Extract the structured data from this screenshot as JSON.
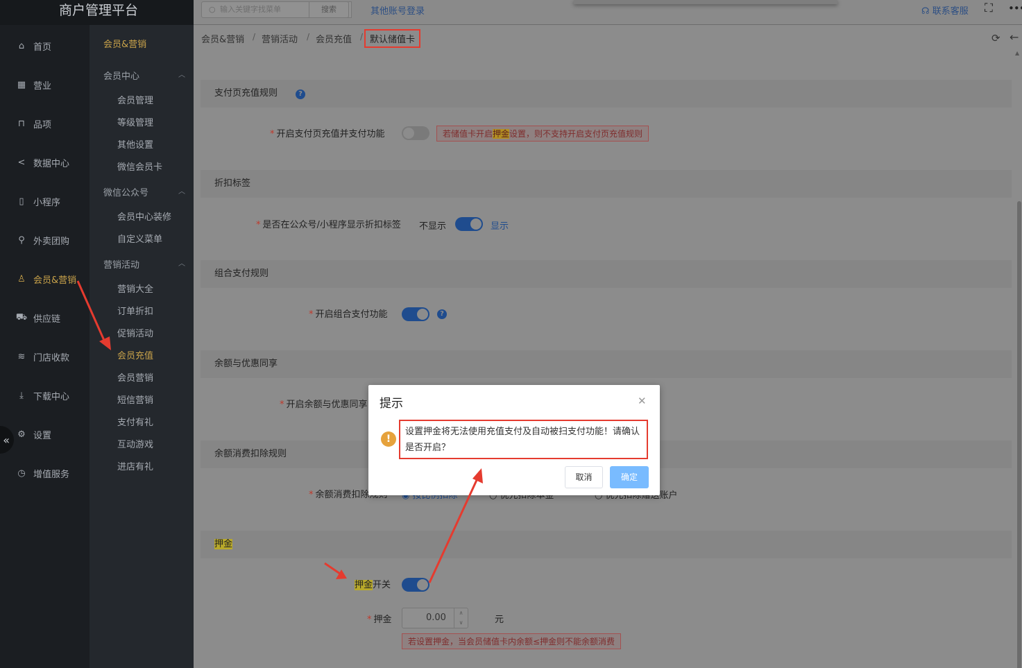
{
  "app": {
    "title": "商户管理平台"
  },
  "topbar": {
    "search_placeholder": "输入关键字找菜单",
    "search_button": "搜索",
    "other_login": "其他账号登录",
    "contact": "联系客服"
  },
  "nav": {
    "items": [
      {
        "label": "首页",
        "icon": "home-icon"
      },
      {
        "label": "营业",
        "icon": "calendar-icon"
      },
      {
        "label": "品项",
        "icon": "bag-icon"
      },
      {
        "label": "数据中心",
        "icon": "share-icon"
      },
      {
        "label": "小程序",
        "icon": "phone-icon"
      },
      {
        "label": "外卖团购",
        "icon": "bike-icon"
      },
      {
        "label": "会员&营销",
        "icon": "user-icon"
      },
      {
        "label": "供应链",
        "icon": "truck-icon"
      },
      {
        "label": "门店收款",
        "icon": "coins-icon"
      },
      {
        "label": "下载中心",
        "icon": "download-icon"
      },
      {
        "label": "设置",
        "icon": "gear-icon"
      },
      {
        "label": "增值服务",
        "icon": "clock-icon"
      }
    ]
  },
  "subnav": {
    "header": "会员&营销",
    "groups": [
      {
        "label": "会员中心",
        "items": [
          "会员管理",
          "等级管理",
          "其他设置",
          "微信会员卡"
        ]
      },
      {
        "label": "微信公众号",
        "items": [
          "会员中心装修",
          "自定义菜单"
        ]
      },
      {
        "label": "营销活动",
        "items": [
          "营销大全",
          "订单折扣",
          "促销活动",
          "会员充值",
          "会员营销",
          "短信营销",
          "支付有礼",
          "互动游戏",
          "进店有礼"
        ]
      }
    ]
  },
  "breadcrumb": [
    "会员&营销",
    "营销活动",
    "会员充值",
    "默认储值卡"
  ],
  "sections": {
    "pay_page": {
      "title": "支付页充值规则",
      "label": "开启支付页充值并支付功能",
      "warn_pre": "若储值卡开启",
      "warn_hl": "押金",
      "warn_post": "设置，则不支持开启支付页充值规则"
    },
    "discount_tag": {
      "title": "折扣标签",
      "label": "是否在公众号/小程序显示折扣标签",
      "off_text": "不显示",
      "on_text": "显示"
    },
    "combined_pay": {
      "title": "组合支付规则",
      "label": "开启组合支付功能"
    },
    "balance_share": {
      "title": "余额与优惠同享",
      "label": "开启余额与优惠同享"
    },
    "balance_deduct": {
      "title": "余额消费扣除规则",
      "label": "余额消费扣除规则",
      "option_1": "按比例扣除",
      "option_2": "优先扣除本金",
      "option_3": "优先扣除赠送账户"
    },
    "deposit": {
      "title": "押金",
      "switch_hl": "押金",
      "switch_rest": "开关",
      "amount_label": "押金",
      "amount_value": "0.00",
      "unit": "元",
      "hint": "若设置押金，当会员储值卡内余额≤押金则不能余额消费"
    }
  },
  "modal": {
    "title": "提示",
    "message": "设置押金将无法使用充值支付及自动被扫支付功能！请确认是否开启？",
    "cancel": "取消",
    "confirm": "确定"
  },
  "colors": {
    "accent_gold": "#c8a24a",
    "annotation_red": "#e53b2f",
    "primary_blue": "#79bbff",
    "warning_orange": "#e6a23c"
  }
}
